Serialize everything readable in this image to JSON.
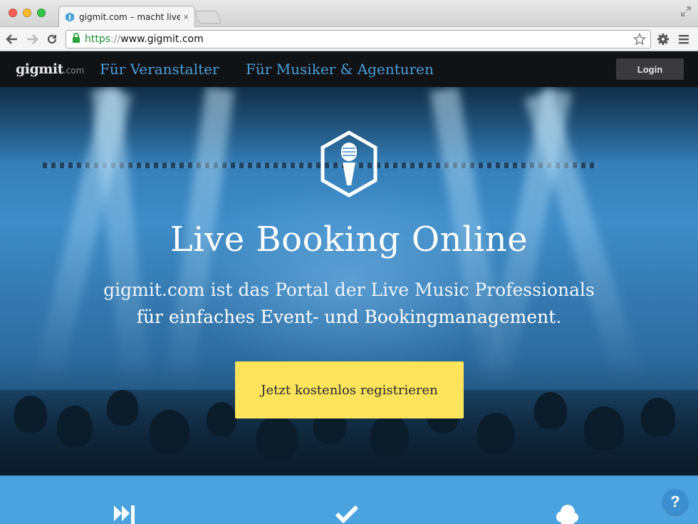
{
  "browser": {
    "tab_title": "gigmit.com – macht live bo",
    "tab_close": "×",
    "url_scheme": "https",
    "url_separator": "://",
    "url_host": "www.gigmit.com"
  },
  "site": {
    "logo_main": "gigmit",
    "logo_tld": ".com",
    "nav": {
      "link1_prefix": "Für ",
      "link1_main": "Veranstalter",
      "link2_prefix": "Für ",
      "link2_main": "Musiker & Agenturen",
      "login_label": "Login"
    },
    "hero": {
      "title": "Live Booking Online",
      "subtitle_line1": "gigmit.com ist das Portal der Live Music Professionals",
      "subtitle_line2": "für einfaches Event- und Bookingmanagement",
      "subtitle_period": ".",
      "cta_label": "Jetzt kostenlos registrieren"
    },
    "features_icons": [
      "fast-forward-icon",
      "checkmark-icon",
      "cloud-icon"
    ],
    "help_label": "?"
  },
  "colors": {
    "nav_bg": "#111214",
    "nav_link": "#4a9fdb",
    "hero_blue": "#3e8cc8",
    "cta_yellow": "#fbe35c",
    "features_bg": "#4aa3de"
  }
}
